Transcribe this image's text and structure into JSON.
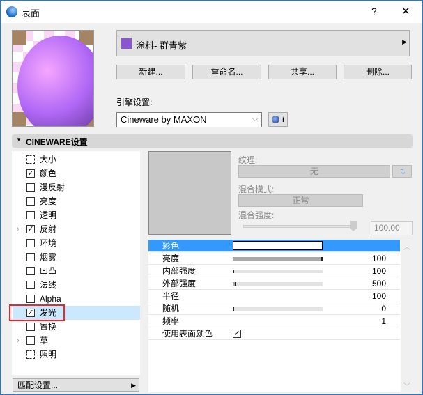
{
  "title": "表面",
  "help": "?",
  "close": "✕",
  "material": {
    "name": "涂料- 群青紫",
    "swatch_color": "#8b55d0"
  },
  "buttons": {
    "new": "新建...",
    "rename": "重命名...",
    "share": "共享...",
    "delete": "删除..."
  },
  "engine": {
    "label": "引擎设置:",
    "selected": "Cineware by MAXON",
    "info": "i"
  },
  "section": {
    "title": "CINEWARE设置"
  },
  "channels": [
    {
      "label": "大小",
      "type": "icon"
    },
    {
      "label": "颜色",
      "checked": true
    },
    {
      "label": "漫反射",
      "checked": false
    },
    {
      "label": "亮度",
      "checked": false
    },
    {
      "label": "透明",
      "checked": false
    },
    {
      "label": "反射",
      "checked": true,
      "expandable": true
    },
    {
      "label": "环境",
      "checked": false
    },
    {
      "label": "烟雾",
      "checked": false
    },
    {
      "label": "凹凸",
      "checked": false
    },
    {
      "label": "法线",
      "checked": false
    },
    {
      "label": "Alpha",
      "checked": false
    },
    {
      "label": "发光",
      "checked": true,
      "selected": true
    },
    {
      "label": "置换",
      "checked": false
    },
    {
      "label": "草",
      "checked": false,
      "expandable": true
    },
    {
      "label": "照明",
      "type": "icon"
    }
  ],
  "match_settings": "匹配设置...",
  "texture": {
    "label": "纹理:",
    "value": "无",
    "blend_mode_label": "混合模式:",
    "blend_mode": "正常",
    "blend_strength_label": "混合强度:",
    "blend_strength": "100.00",
    "blend_strength_fraction": 1.0
  },
  "properties": [
    {
      "label": "彩色",
      "type": "color",
      "color": "#ffffff",
      "selected": true
    },
    {
      "label": "亮度",
      "value": "100",
      "fraction": 1.0
    },
    {
      "label": "内部强度",
      "value": "100",
      "fraction": 0.0
    },
    {
      "label": "外部强度",
      "value": "500",
      "fraction": 0.04
    },
    {
      "label": "半径",
      "value": "100"
    },
    {
      "label": "随机",
      "value": "0",
      "fraction": 0.0
    },
    {
      "label": "频率",
      "value": "1"
    },
    {
      "label": "使用表面颜色",
      "type": "checkbox",
      "checked": true
    }
  ],
  "colors": {
    "accent": "#3399ff",
    "selected_row": "#cce8ff",
    "highlight_box": "#e8262b"
  }
}
